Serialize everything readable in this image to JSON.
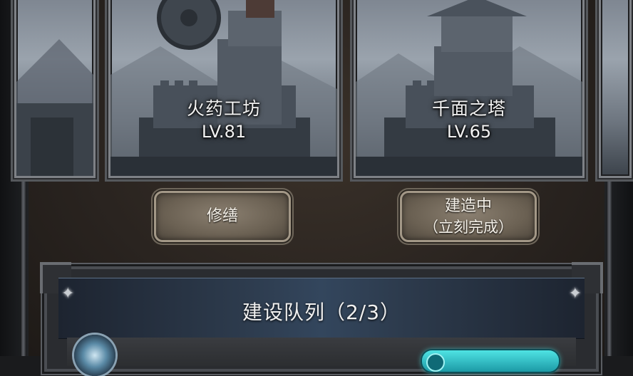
{
  "buildings": [
    {
      "name": "火药工坊",
      "level": "LV.81"
    },
    {
      "name": "千面之塔",
      "level": "LV.65"
    }
  ],
  "actions": {
    "repair_label": "修缮",
    "building_label": "建造中",
    "instant_label": "（立刻完成）"
  },
  "queue": {
    "title": "建设队列（2/3）"
  },
  "colors": {
    "button_face": "#6b6153",
    "panel_header": "#2d3b4d",
    "go_button": "#2ab6be"
  },
  "icons": [
    "sparkle-icon",
    "shield-emblem-icon",
    "gear-icon"
  ]
}
